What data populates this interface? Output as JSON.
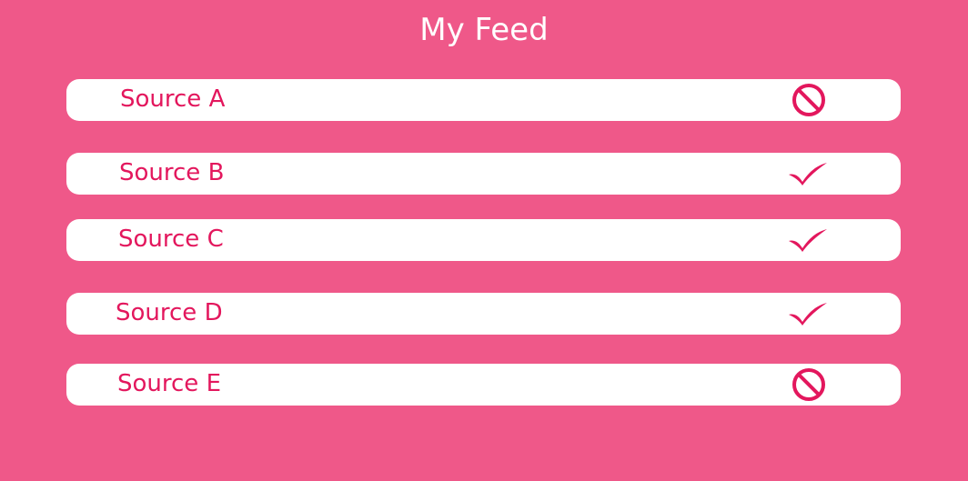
{
  "header": {
    "title": "My Feed"
  },
  "colors": {
    "background": "#ef5889",
    "row_background": "#ffffff",
    "accent": "#e3175d",
    "title_text": "#ffffff"
  },
  "sources": [
    {
      "label": "Source A",
      "status": "blocked",
      "icon": "block-icon"
    },
    {
      "label": "Source B",
      "status": "enabled",
      "icon": "check-icon"
    },
    {
      "label": "Source C",
      "status": "enabled",
      "icon": "check-icon"
    },
    {
      "label": "Source D",
      "status": "enabled",
      "icon": "check-icon"
    },
    {
      "label": "Source E",
      "status": "blocked",
      "icon": "block-icon"
    }
  ]
}
